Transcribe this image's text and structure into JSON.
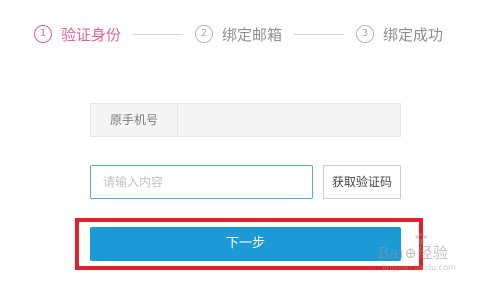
{
  "steps": [
    {
      "number": "1",
      "label": "验证身份"
    },
    {
      "number": "2",
      "label": "绑定邮箱"
    },
    {
      "number": "3",
      "label": "绑定成功"
    }
  ],
  "active_step": 1,
  "colors": {
    "active": "#e2649a",
    "primary_button": "#1c9ad6",
    "highlight_border": "#e0202a",
    "input_focus_border": "#5aa8dd"
  },
  "form": {
    "phone_label": "原手机号",
    "phone_value": "",
    "code_placeholder": "请输入内容",
    "code_value": "",
    "get_code_label": "获取验证码",
    "next_label": "下一步"
  },
  "watermark": {
    "main": "Bai⊕经验",
    "sub": "jingyan.baidu.com"
  }
}
